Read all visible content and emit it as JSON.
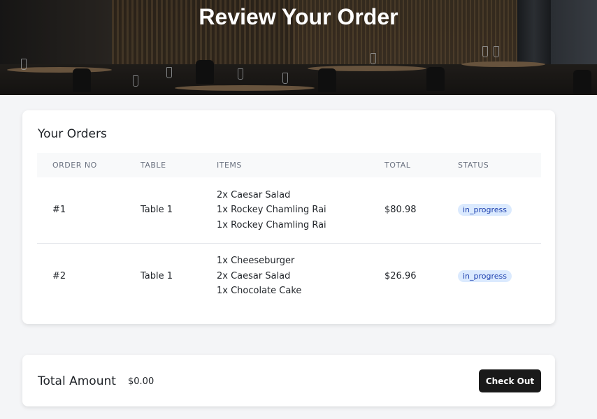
{
  "hero": {
    "title": "Review Your Order"
  },
  "orders": {
    "heading": "Your Orders",
    "columns": [
      "ORDER NO",
      "TABLE",
      "ITEMS",
      "TOTAL",
      "STATUS"
    ],
    "rows": [
      {
        "order_no": "#1",
        "table": "Table 1",
        "items": [
          "2x Caesar Salad",
          "1x Rockey Chamling Rai",
          "1x Rockey Chamling Rai"
        ],
        "total": "$80.98",
        "status": "in_progress"
      },
      {
        "order_no": "#2",
        "table": "Table 1",
        "items": [
          "1x Cheeseburger",
          "2x Caesar Salad",
          "1x Chocolate Cake"
        ],
        "total": "$26.96",
        "status": "in_progress"
      }
    ]
  },
  "summary": {
    "label": "Total Amount",
    "value": "$0.00",
    "checkout_label": "Check Out"
  },
  "colors": {
    "badge_bg": "#dbeafe",
    "badge_text": "#1e40af",
    "button_bg": "#1a1a1a"
  }
}
